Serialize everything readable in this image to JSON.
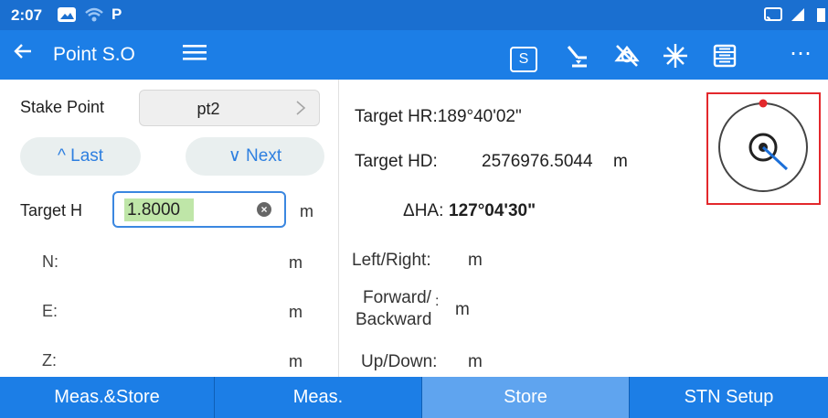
{
  "status_bar": {
    "time": "2:07",
    "icons": [
      "gallery-icon",
      "wifi-icon",
      "parking-app-icon",
      "cast-icon",
      "signal-icon",
      "battery-icon"
    ]
  },
  "title_bar": {
    "title": "Point S.O",
    "s_button": "S",
    "icons": [
      "back-arrow-icon",
      "menu-icon",
      "level-icon",
      "no-prism-icon",
      "laser-icon",
      "list-icon",
      "more-icon"
    ],
    "more": "⋯"
  },
  "left_panel": {
    "stake_point_label": "Stake Point",
    "stake_point_value": "pt2",
    "last_button": "^ Last",
    "next_button": "∨ Next",
    "target_h_label": "Target H",
    "target_h_value": "1.8000",
    "unit": "m",
    "n_label": "N:",
    "e_label": "E:",
    "z_label": "Z:"
  },
  "right_panel": {
    "target_hr": "Target HR:189°40'02\"",
    "target_hd_label": "Target HD:",
    "target_hd_value": "2576976.5044",
    "unit": "m",
    "delta_ha_label": "ΔHA:",
    "delta_ha_value": "127°04'30\"",
    "left_right_label": "Left/Right:",
    "forward_label_line1": "Forward/",
    "forward_label_line2": "Backward",
    "forward_colon": ":",
    "up_down_label": "Up/Down:"
  },
  "colors": {
    "title_bar": "#1c7ee6",
    "status_bar": "#1a6fd0",
    "accent": "#2d7fe0",
    "highlight": "#bfe6a8",
    "frame": "#e3282c"
  },
  "bottom_tabs": [
    {
      "label": "Meas.&Store"
    },
    {
      "label": "Meas."
    },
    {
      "label": "Store"
    },
    {
      "label": "STN Setup"
    }
  ]
}
